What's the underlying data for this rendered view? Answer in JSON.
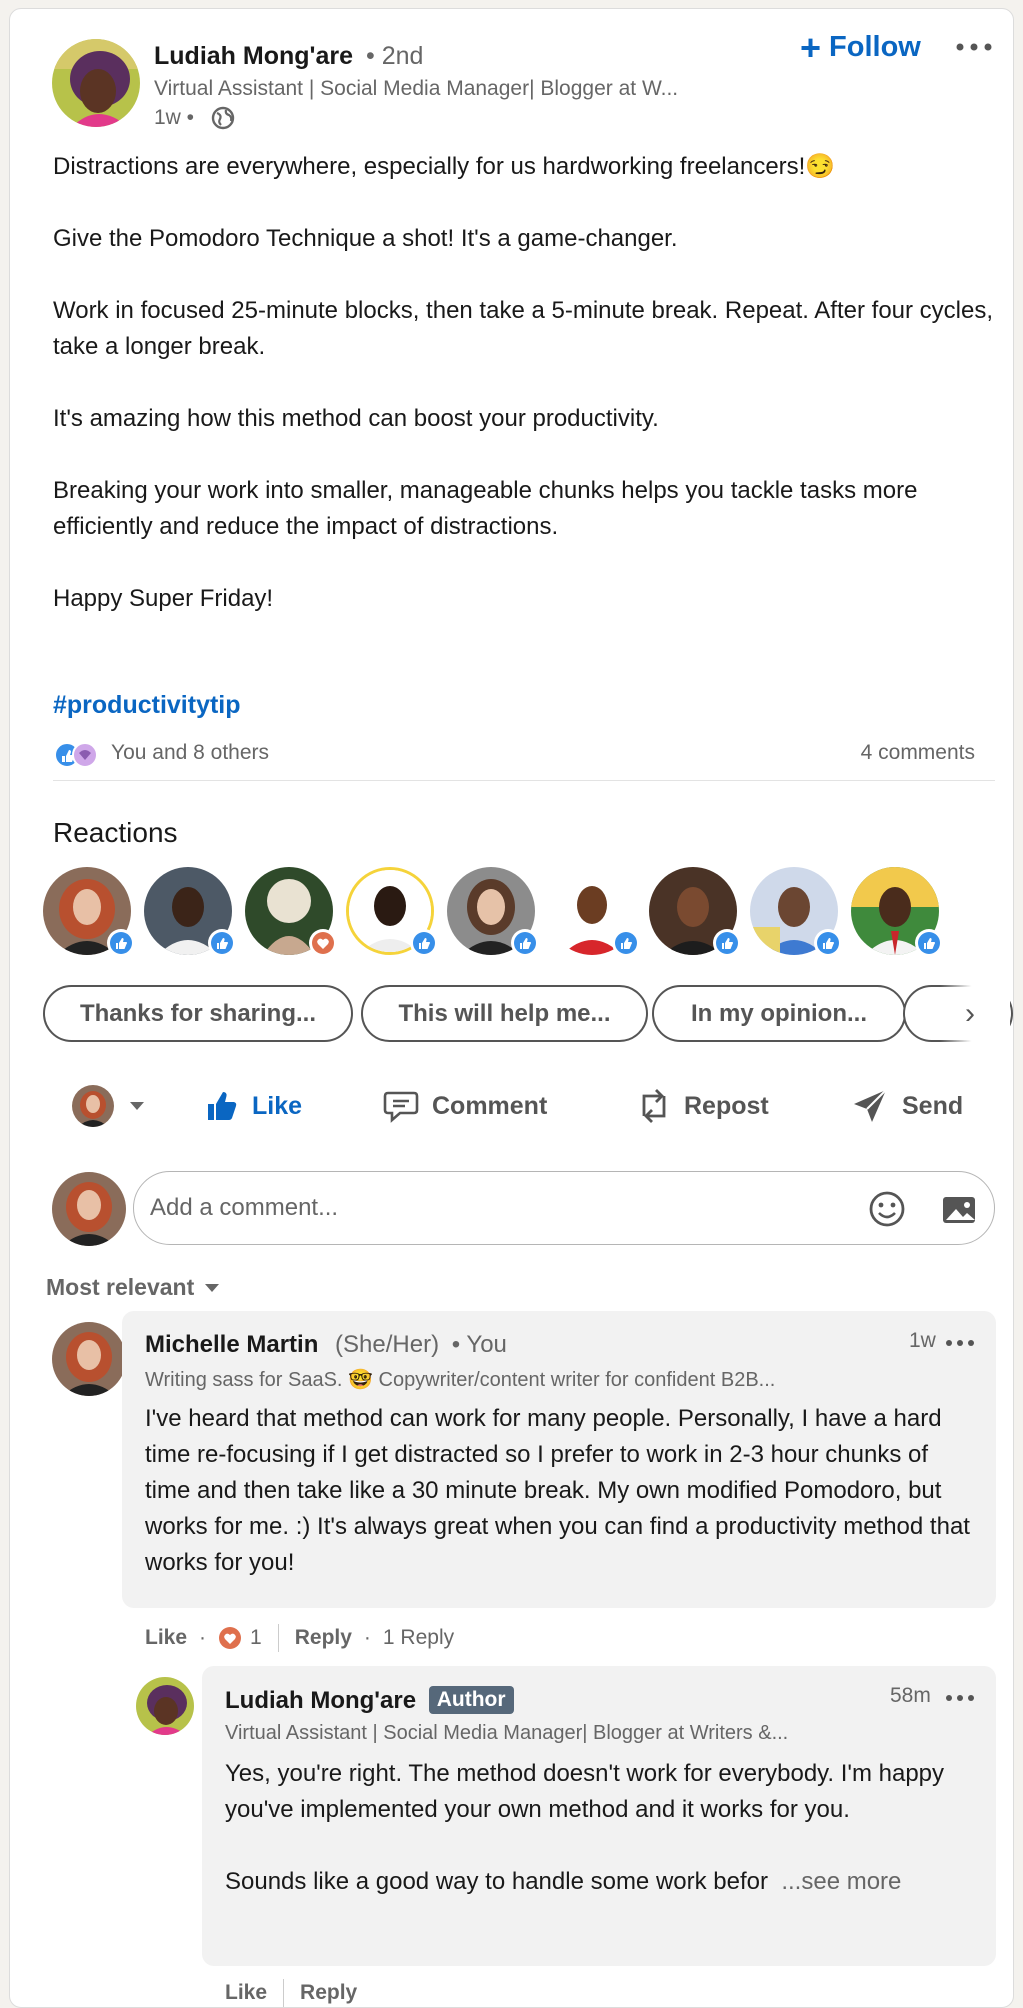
{
  "post": {
    "author_name": "Ludiah Mong'are",
    "author_degree": "• 2nd",
    "author_headline": "Virtual Assistant | Social Media Manager| Blogger at W...",
    "time": "1w •",
    "follow_label": "Follow",
    "paragraphs": [
      "Distractions are everywhere, especially for us hardworking freelancers!😏\n\n",
      "Give the Pomodoro Technique a shot! It's a game-changer.",
      "Work in focused 25-minute blocks, then take a 5-minute break. Repeat. After four cycles, take a longer break.",
      "It's amazing how this method can boost your productivity.",
      "Breaking your work into smaller, manageable chunks helps you tackle tasks more efficiently and reduce the impact of distractions.",
      "Happy Super Friday!"
    ],
    "hashtag": "#productivitytip",
    "reactions_text": "You and 8 others",
    "comments_count": "4 comments"
  },
  "reactions": {
    "title": "Reactions",
    "people": [
      {
        "icon": "like-icon"
      },
      {
        "icon": "like-icon"
      },
      {
        "icon": "love-icon"
      },
      {
        "icon": "like-icon"
      },
      {
        "icon": "like-icon"
      },
      {
        "icon": "like-icon"
      },
      {
        "icon": "like-icon"
      },
      {
        "icon": "like-icon"
      },
      {
        "icon": "like-icon"
      }
    ]
  },
  "suggestions": [
    "Thanks for sharing...",
    "This will help me...",
    "In my opinion..."
  ],
  "actions": {
    "like": "Like",
    "comment": "Comment",
    "repost": "Repost",
    "send": "Send"
  },
  "comment_box": {
    "placeholder": "Add a comment..."
  },
  "sort_label": "Most relevant",
  "comments": [
    {
      "name": "Michelle Martin",
      "pronoun": "(She/Her)",
      "you": "• You",
      "headline": "Writing sass for SaaS. 🤓 Copywriter/content writer for confident B2B...",
      "time": "1w",
      "text": "I've heard that method can work for many people. Personally, I have a hard time re-focusing if I get distracted so I prefer to work in 2-3 hour chunks of time and then take like a 30 minute break. My own modified Pomodoro, but works for me. :) It's always great when you can find a productivity method that works for you!",
      "like": "Like",
      "reaction_count": "1",
      "reply": "Reply",
      "replies": "1 Reply"
    },
    {
      "name": "Ludiah Mong'are",
      "badge": "Author",
      "headline": "Virtual Assistant | Social Media Manager| Blogger at Writers &...",
      "time": "58m",
      "text": "Yes, you're right. The method doesn't work for everybody. I'm happy you've implemented your own method and it works for you.\n\nSounds like a good way to handle some work befor",
      "see_more": "...see more",
      "like": "Like",
      "reply": "Reply"
    }
  ],
  "colors": {
    "brand_blue": "#0a66c2",
    "muted": "#666666",
    "bubble": "#f2f2f2",
    "author_badge": "#56687a"
  }
}
